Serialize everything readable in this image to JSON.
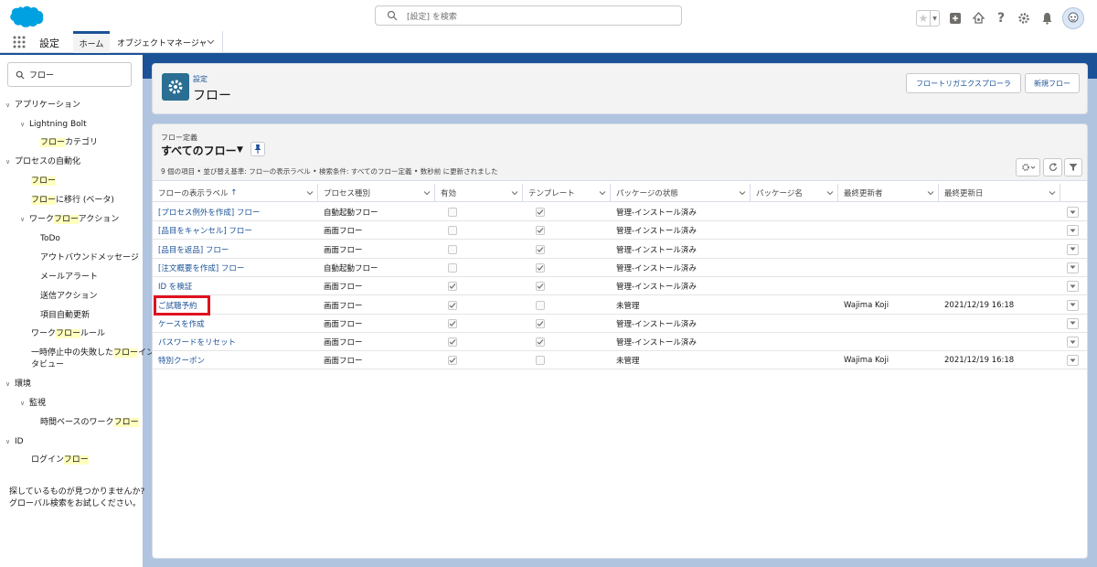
{
  "header": {
    "search_placeholder": "[設定] を検索"
  },
  "nav": {
    "app_name": "設定",
    "tab_home": "ホーム",
    "tab_object_manager": "オブジェクトマネージャ"
  },
  "sidebar": {
    "search_value": "フロー",
    "items": {
      "apps": "アプリケーション",
      "lightning_bolt": "Lightning Bolt",
      "flow_category_hl": "フロー",
      "flow_category_rest": "カテゴリ",
      "process_automation": "プロセスの自動化",
      "flows_hl": "フロー",
      "migrate_hl": "フロー",
      "migrate_rest": "に移行 (ベータ)",
      "workflow_actions_pre": "ワーク",
      "workflow_actions_hl": "フロー",
      "workflow_actions_post": "アクション",
      "todo": "ToDo",
      "outbound_message": "アウトバウンドメッセージ",
      "email_alert": "メールアラート",
      "send_action": "送信アクション",
      "field_update": "項目自動更新",
      "workflow_rules_pre": "ワーク",
      "workflow_rules_hl": "フロー",
      "workflow_rules_post": "ルール",
      "paused_pre": "一時停止中の失敗した",
      "paused_hl": "フロー",
      "paused_post": "イン",
      "paused_line2": "タビュー",
      "environments": "環境",
      "monitoring": "監視",
      "time_based_pre": "時間ベースのワーク",
      "time_based_hl": "フロー",
      "id": "ID",
      "login_pre": "ログイン",
      "login_hl": "フロー"
    },
    "footer_line1": "探しているものが見つかりませんか?",
    "footer_line2": "グローバル検索をお試しください。"
  },
  "page": {
    "breadcrumb": "設定",
    "title": "フロー",
    "btn_explorer": "フロートリガエクスプローラ",
    "btn_new": "新規フロー"
  },
  "listview": {
    "subtitle": "フロー定義",
    "title": "すべてのフロー",
    "info": "9 個の項目 • 並び替え基準: フローの表示ラベル • 検索条件: すべてのフロー定義 • 数秒前 に更新されました"
  },
  "table": {
    "columns": [
      "フローの表示ラベル",
      "プロセス種別",
      "有効",
      "テンプレート",
      "パッケージの状態",
      "パッケージ名",
      "最終更新者",
      "最終更新日"
    ],
    "sort_indicator": "↑",
    "rows": [
      {
        "label": "[プロセス例外を作成] フロー",
        "type": "自動起動フロー",
        "active": false,
        "template": true,
        "pkg_state": "管理-インストール済み",
        "pkg_name": "",
        "modified_by": "",
        "modified_date": ""
      },
      {
        "label": "[品目をキャンセル] フロー",
        "type": "画面フロー",
        "active": false,
        "template": true,
        "pkg_state": "管理-インストール済み",
        "pkg_name": "",
        "modified_by": "",
        "modified_date": ""
      },
      {
        "label": "[品目を返品] フロー",
        "type": "画面フロー",
        "active": false,
        "template": true,
        "pkg_state": "管理-インストール済み",
        "pkg_name": "",
        "modified_by": "",
        "modified_date": ""
      },
      {
        "label": "[注文概要を作成] フロー",
        "type": "自動起動フロー",
        "active": false,
        "template": true,
        "pkg_state": "管理-インストール済み",
        "pkg_name": "",
        "modified_by": "",
        "modified_date": ""
      },
      {
        "label": "ID を検証",
        "type": "画面フロー",
        "active": true,
        "template": true,
        "pkg_state": "管理-インストール済み",
        "pkg_name": "",
        "modified_by": "",
        "modified_date": ""
      },
      {
        "label": "ご試聴予約",
        "type": "画面フロー",
        "active": true,
        "template": false,
        "pkg_state": "未管理",
        "pkg_name": "",
        "modified_by": "Wajima Koji",
        "modified_date": "2021/12/19 16:18"
      },
      {
        "label": "ケースを作成",
        "type": "画面フロー",
        "active": true,
        "template": true,
        "pkg_state": "管理-インストール済み",
        "pkg_name": "",
        "modified_by": "",
        "modified_date": ""
      },
      {
        "label": "パスワードをリセット",
        "type": "画面フロー",
        "active": true,
        "template": true,
        "pkg_state": "管理-インストール済み",
        "pkg_name": "",
        "modified_by": "",
        "modified_date": ""
      },
      {
        "label": "特別クーポン",
        "type": "画面フロー",
        "active": true,
        "template": false,
        "pkg_state": "未管理",
        "pkg_name": "",
        "modified_by": "Wajima Koji",
        "modified_date": "2021/12/19 16:18"
      }
    ]
  },
  "colors": {
    "brand_blue": "#1b5297",
    "link_blue": "#1b5297",
    "highlight_red": "#e0121f",
    "search_highlight": "#ffffbf",
    "bg_blue": "#b0c4df"
  }
}
